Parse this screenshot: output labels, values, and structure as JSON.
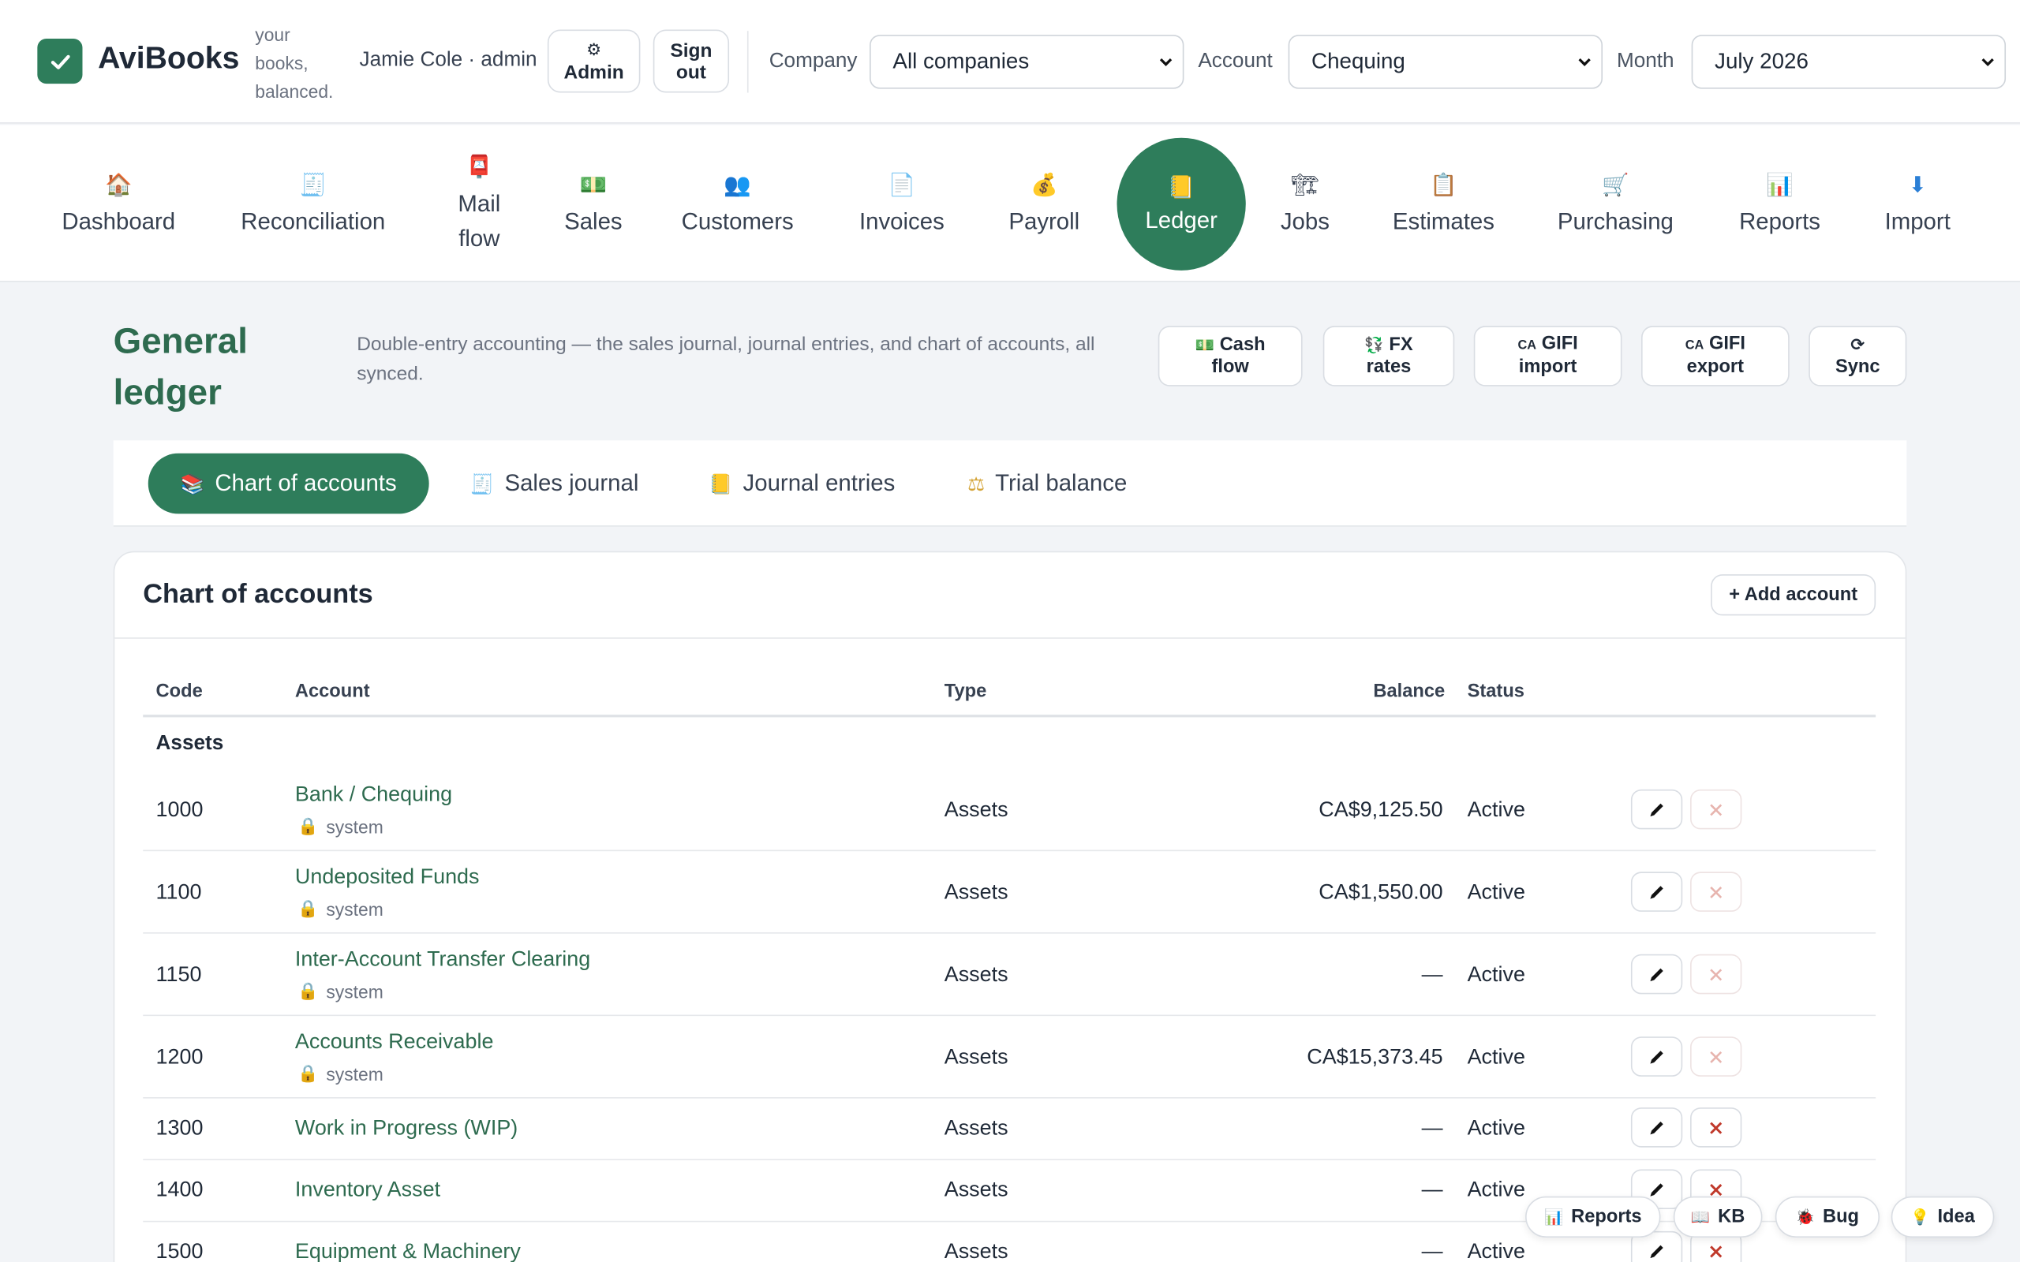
{
  "header": {
    "app_name": "AviBooks",
    "tagline": "your books, balanced.",
    "user": "Jamie Cole · admin",
    "admin_btn": "Admin",
    "admin_icon": "⚙",
    "signout_btn_line1": "Sign",
    "signout_btn_line2": "out",
    "company_label": "Company",
    "company_value": "All companies",
    "account_label": "Account",
    "account_value": "Chequing",
    "month_label": "Month",
    "month_value": "July 2026"
  },
  "nav": {
    "items": [
      {
        "label": "Dashboard",
        "icon": "🏠"
      },
      {
        "label": "Reconciliation",
        "icon": "🧾"
      },
      {
        "label": "Mail flow",
        "icon": "📮"
      },
      {
        "label": "Sales",
        "icon": "💵"
      },
      {
        "label": "Customers",
        "icon": "👥"
      },
      {
        "label": "Invoices",
        "icon": "📄"
      },
      {
        "label": "Payroll",
        "icon": "💰"
      },
      {
        "label": "Ledger",
        "icon": "📒"
      },
      {
        "label": "Jobs",
        "icon": "🏗"
      },
      {
        "label": "Estimates",
        "icon": "📋"
      },
      {
        "label": "Purchasing",
        "icon": "🛒"
      },
      {
        "label": "Reports",
        "icon": "📊"
      },
      {
        "label": "Import",
        "icon": "⬇"
      }
    ],
    "active": "Ledger"
  },
  "page": {
    "title": "General ledger",
    "description": "Double-entry accounting — the sales journal, journal entries, and chart of accounts, all synced.",
    "actions": [
      {
        "icon": "💵",
        "line1": "Cash",
        "line2": "flow"
      },
      {
        "icon": "💱",
        "line1": "FX",
        "line2": "rates"
      },
      {
        "icon": "CA",
        "line1": "GIFI",
        "line2": "import"
      },
      {
        "icon": "CA",
        "line1": "GIFI",
        "line2": "export"
      },
      {
        "icon": "⟳",
        "line1": "Sync",
        "line2": ""
      }
    ]
  },
  "tabs": [
    {
      "label": "Chart of accounts",
      "icon": "📚",
      "active": true
    },
    {
      "label": "Sales journal",
      "icon": "🧾",
      "active": false
    },
    {
      "label": "Journal entries",
      "icon": "📒",
      "active": false
    },
    {
      "label": "Trial balance",
      "icon": "⚖",
      "active": false
    }
  ],
  "card": {
    "title": "Chart of accounts",
    "add_button": "+ Add account"
  },
  "table": {
    "headers": {
      "code": "Code",
      "account": "Account",
      "type": "Type",
      "balance": "Balance",
      "status": "Status"
    },
    "group": "Assets",
    "system_label": "system",
    "rows": [
      {
        "code": "1000",
        "account": "Bank / Chequing",
        "system": true,
        "type": "Assets",
        "balance": "CA$9,125.50",
        "status": "Active",
        "deletable": false
      },
      {
        "code": "1100",
        "account": "Undeposited Funds",
        "system": true,
        "type": "Assets",
        "balance": "CA$1,550.00",
        "status": "Active",
        "deletable": false
      },
      {
        "code": "1150",
        "account": "Inter-Account Transfer Clearing",
        "system": true,
        "type": "Assets",
        "balance": "—",
        "status": "Active",
        "deletable": false
      },
      {
        "code": "1200",
        "account": "Accounts Receivable",
        "system": true,
        "type": "Assets",
        "balance": "CA$15,373.45",
        "status": "Active",
        "deletable": false
      },
      {
        "code": "1300",
        "account": "Work in Progress (WIP)",
        "system": false,
        "type": "Assets",
        "balance": "—",
        "status": "Active",
        "deletable": true
      },
      {
        "code": "1400",
        "account": "Inventory Asset",
        "system": false,
        "type": "Assets",
        "balance": "—",
        "status": "Active",
        "deletable": true
      },
      {
        "code": "1500",
        "account": "Equipment & Machinery",
        "system": false,
        "type": "Assets",
        "balance": "—",
        "status": "Active",
        "deletable": true
      }
    ]
  },
  "floating": {
    "reports": "Reports",
    "kb": "KB",
    "bug": "Bug",
    "idea": "Idea"
  },
  "colors": {
    "brand": "#2e7d5b",
    "title": "#2e6b4f",
    "delete": "#c0392b",
    "delete_faded": "#e7b4ae"
  }
}
